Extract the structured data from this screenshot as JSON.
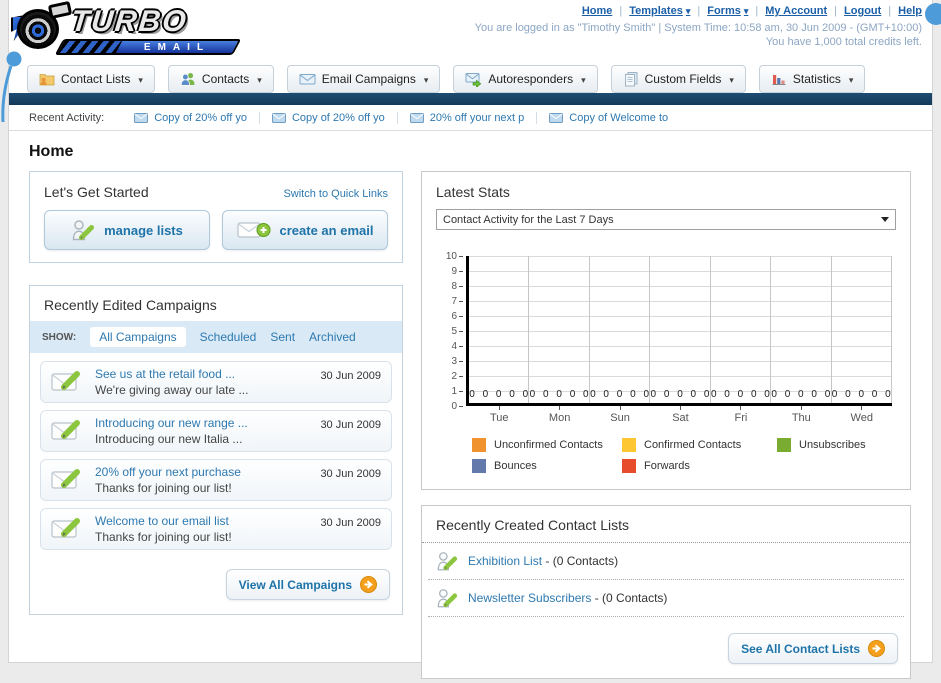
{
  "header": {
    "brand": {
      "name": "TURBO",
      "sub": "EMAIL"
    },
    "links": [
      {
        "label": "Home",
        "dropdown": false
      },
      {
        "label": "Templates",
        "dropdown": true
      },
      {
        "label": "Forms",
        "dropdown": true
      },
      {
        "label": "My Account",
        "dropdown": false
      },
      {
        "label": "Logout",
        "dropdown": false
      },
      {
        "label": "Help",
        "dropdown": false
      }
    ],
    "login_status": "You are logged in as \"Timothy Smith\" | System Time: 10:58 am, 30 Jun 2009 - (GMT+10:00)",
    "credits": "You have 1,000 total credits left."
  },
  "nav": {
    "tabs": [
      {
        "label": "Contact Lists",
        "icon": "contact-lists-icon"
      },
      {
        "label": "Contacts",
        "icon": "contacts-icon"
      },
      {
        "label": "Email Campaigns",
        "icon": "email-campaigns-icon"
      },
      {
        "label": "Autoresponders",
        "icon": "autoresponders-icon"
      },
      {
        "label": "Custom Fields",
        "icon": "custom-fields-icon"
      },
      {
        "label": "Statistics",
        "icon": "statistics-icon"
      }
    ]
  },
  "recent_activity": {
    "label": "Recent Activity:",
    "items": [
      {
        "label": "Copy of 20% off yo"
      },
      {
        "label": "Copy of 20% off yo"
      },
      {
        "label": "20% off your next p"
      },
      {
        "label": "Copy of Welcome to"
      }
    ]
  },
  "page": {
    "title": "Home"
  },
  "get_started": {
    "title": "Let's Get Started",
    "switch_link": "Switch to Quick Links",
    "manage_lists_label": "manage lists",
    "create_email_label": "create an email"
  },
  "campaigns": {
    "title": "Recently Edited Campaigns",
    "show_label": "SHOW:",
    "filters": [
      {
        "label": "All Campaigns",
        "selected": true
      },
      {
        "label": "Scheduled",
        "selected": false
      },
      {
        "label": "Sent",
        "selected": false
      },
      {
        "label": "Archived",
        "selected": false
      }
    ],
    "items": [
      {
        "title": "See us at the retail food ...",
        "subtitle": "We're giving away our late ...",
        "date": "30 Jun 2009"
      },
      {
        "title": "Introducing our new range ...",
        "subtitle": "Introducing our new Italia ...",
        "date": "30 Jun 2009"
      },
      {
        "title": "20% off your next purchase",
        "subtitle": "Thanks for joining our list!",
        "date": "30 Jun 2009"
      },
      {
        "title": "Welcome to our email list",
        "subtitle": "Thanks for joining our list!",
        "date": "30 Jun 2009"
      }
    ],
    "view_all_label": "View All Campaigns"
  },
  "stats": {
    "title": "Latest Stats",
    "selected_option": "Contact Activity for the Last 7 Days"
  },
  "chart_data": {
    "type": "bar",
    "title": "Contact Activity for the Last 7 Days",
    "categories": [
      "Tue",
      "Mon",
      "Sun",
      "Sat",
      "Fri",
      "Thu",
      "Wed"
    ],
    "series": [
      {
        "name": "Unconfirmed Contacts",
        "color": "#F0932F",
        "values": [
          0,
          0,
          0,
          0,
          0,
          0,
          0
        ]
      },
      {
        "name": "Confirmed Contacts",
        "color": "#FCC732",
        "values": [
          0,
          0,
          0,
          0,
          0,
          0,
          0
        ]
      },
      {
        "name": "Unsubscribes",
        "color": "#79AC31",
        "values": [
          0,
          0,
          0,
          0,
          0,
          0,
          0
        ]
      },
      {
        "name": "Bounces",
        "color": "#6379AC",
        "values": [
          0,
          0,
          0,
          0,
          0,
          0,
          0
        ]
      },
      {
        "name": "Forwards",
        "color": "#E74C2C",
        "values": [
          0,
          0,
          0,
          0,
          0,
          0,
          0
        ]
      }
    ],
    "ylim": [
      0,
      10
    ],
    "yticks": [
      10,
      9,
      8,
      7,
      6,
      5,
      4,
      3,
      2,
      1,
      0
    ],
    "grid": true,
    "legend_position": "bottom",
    "value_labels_shown": true
  },
  "contact_lists": {
    "title": "Recently Created Contact Lists",
    "items": [
      {
        "name": "Exhibition List",
        "suffix": " - (0 Contacts)"
      },
      {
        "name": "Newsletter Subscribers",
        "suffix": " - (0 Contacts)"
      }
    ],
    "see_all_label": "See All Contact Lists"
  },
  "colors": {
    "accent_blue": "#1E73A8",
    "link_blue": "#1B5FA8",
    "navy_bar": "#163D5C",
    "orange_arrow": "#F4A01C",
    "balloon_blue": "#4D9BD8"
  }
}
